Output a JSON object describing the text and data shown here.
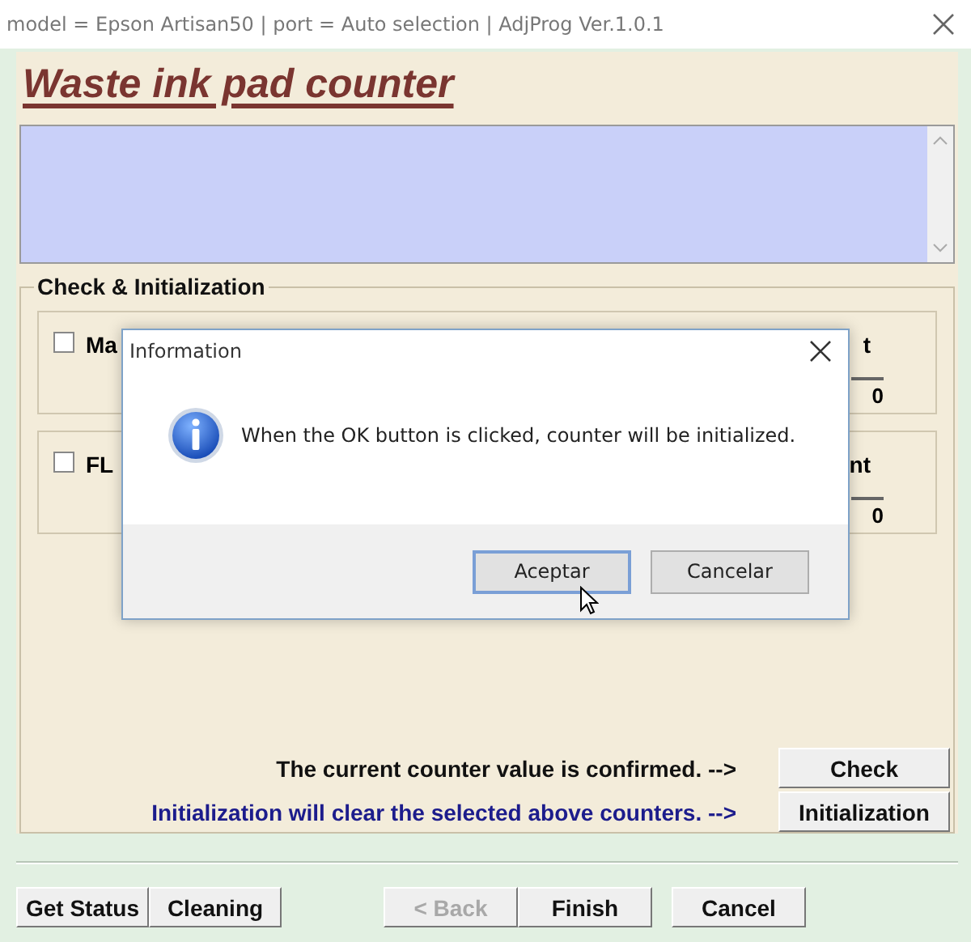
{
  "window": {
    "title": "model = Epson Artisan50 | port = Auto selection | AdjProg Ver.1.0.1"
  },
  "heading": "Waste ink pad counter",
  "group": {
    "title": "Check & Initialization",
    "counters": [
      {
        "label": "Ma",
        "label_end": "t",
        "value": "0",
        "checked": false
      },
      {
        "label": "FL",
        "label_end": "nt",
        "value": "0",
        "checked": false
      }
    ]
  },
  "actions": [
    {
      "kind": "info",
      "text": "The current counter value is confirmed. -->",
      "button": "Check"
    },
    {
      "kind": "warning",
      "text": "Initialization will clear the selected above counters. -->",
      "button": "Initialization"
    }
  ],
  "buttons": [
    {
      "label": "Get Status",
      "disabled": false
    },
    {
      "label": "Cleaning",
      "disabled": false
    },
    {
      "label": "< Back",
      "disabled": true
    },
    {
      "label": "Finish",
      "disabled": false
    },
    {
      "label": "Cancel",
      "disabled": false
    }
  ],
  "dialog": {
    "title": "Information",
    "message": "When the OK button is clicked, counter will be initialized.",
    "buttons": [
      {
        "label": "Aceptar",
        "selected": true
      },
      {
        "label": "Cancelar",
        "selected": false
      }
    ]
  }
}
